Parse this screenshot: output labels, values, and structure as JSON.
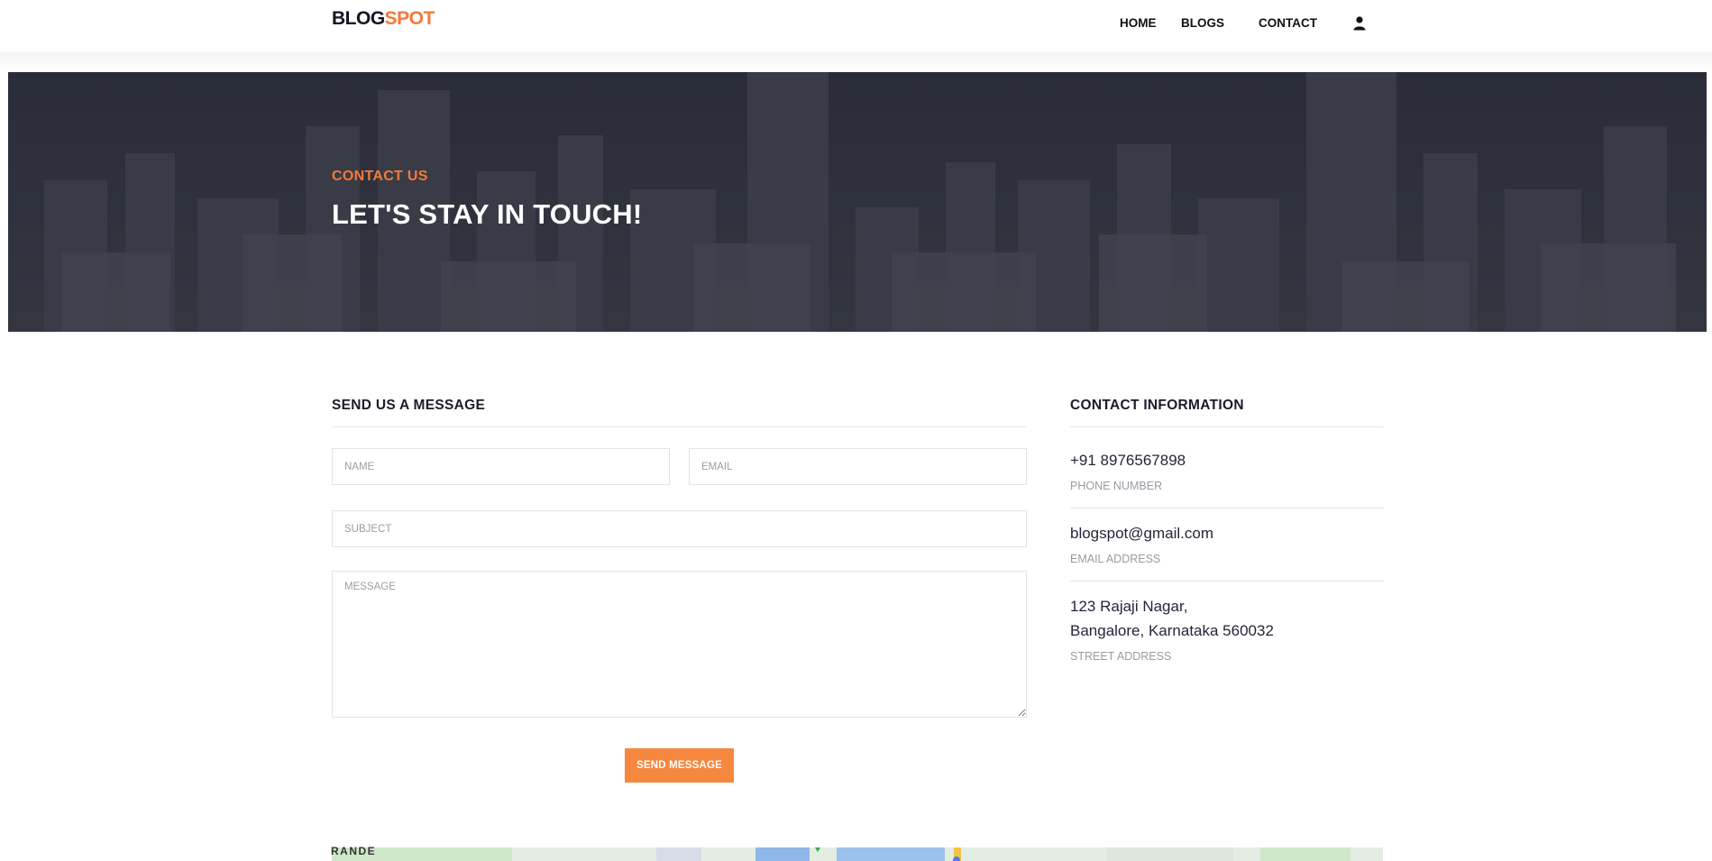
{
  "header": {
    "logo_part1": "BLOG",
    "logo_part2": "SPOT",
    "nav": [
      "HOME",
      "BLOGS",
      "CONTACT"
    ],
    "user_icon": "user-icon"
  },
  "hero": {
    "subtitle": "CONTACT US",
    "title": "LET'S STAY IN TOUCH!"
  },
  "form": {
    "heading": "SEND US A MESSAGE",
    "name_placeholder": "NAME",
    "email_placeholder": "EMAIL",
    "subject_placeholder": "SUBJECT",
    "message_placeholder": "MESSAGE",
    "name_value": "",
    "email_value": "",
    "subject_value": "",
    "message_value": "",
    "send_label": "SEND MESSAGE"
  },
  "contact": {
    "heading": "CONTACT INFORMATION",
    "phone": "+91 8976567898",
    "phone_label": "PHONE NUMBER",
    "email": "blogspot@gmail.com",
    "email_label": "EMAIL ADDRESS",
    "address_line1": "123 Rajaji Nagar,",
    "address_line2": "Bangalore, Karnataka 560032",
    "address_label": "STREET ADDRESS"
  },
  "map": {
    "label": "RANDE"
  },
  "colors": {
    "accent": "#f5793b",
    "button": "#f5873f",
    "hero_bg": "#2d303b",
    "text_dark": "#1b1b2a"
  }
}
